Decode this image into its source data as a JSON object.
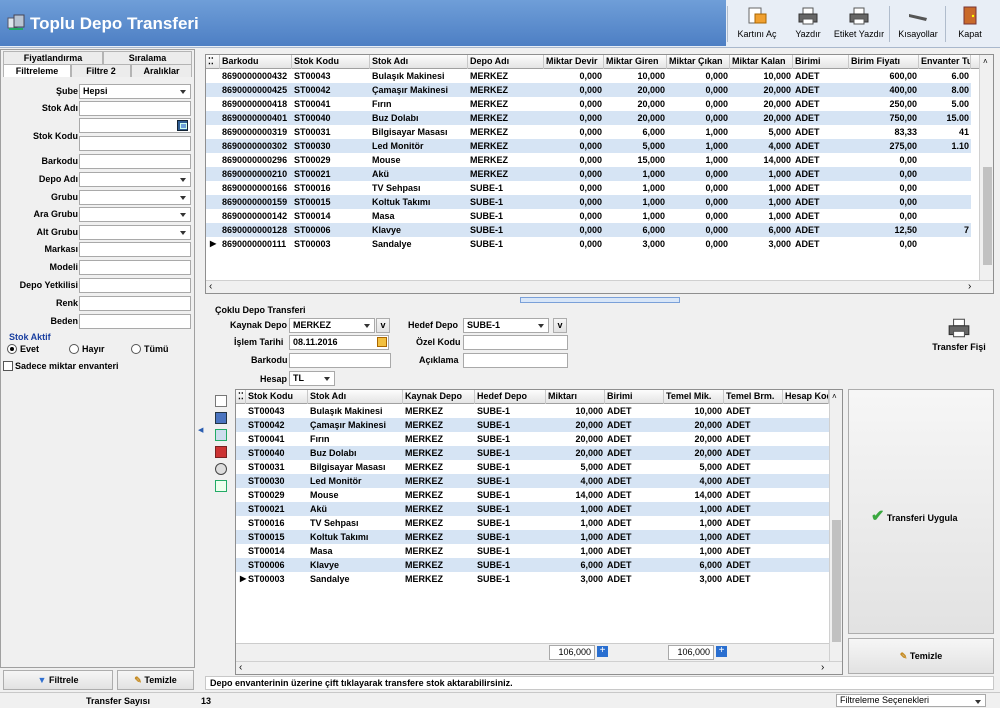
{
  "window": {
    "title": "Toplu Depo Transferi"
  },
  "toolbar": [
    {
      "label": "Kartını Aç",
      "icon": "card-open-icon"
    },
    {
      "label": "Yazdır",
      "icon": "printer-icon"
    },
    {
      "label": "Etiket Yazdır",
      "icon": "label-printer-icon"
    },
    {
      "label": "Kısayollar",
      "icon": "shortcuts-icon"
    },
    {
      "label": "Kapat",
      "icon": "close-door-icon"
    }
  ],
  "left": {
    "tabs_top": [
      "Fiyatlandırma",
      "Sıralama"
    ],
    "tabs_bottom": [
      "Filtreleme",
      "Filtre 2",
      "Aralıklar"
    ],
    "fields": {
      "sube": {
        "label": "Şube",
        "value": "Hepsi"
      },
      "stok_adi": {
        "label": "Stok Adı",
        "value": ""
      },
      "stok_kodu": {
        "label": "Stok Kodu",
        "value": ""
      },
      "barkodu": {
        "label": "Barkodu",
        "value": ""
      },
      "depo_adi": {
        "label": "Depo Adı",
        "value": ""
      },
      "grubu": {
        "label": "Grubu",
        "value": ""
      },
      "ara_grubu": {
        "label": "Ara Grubu",
        "value": ""
      },
      "alt_grubu": {
        "label": "Alt Grubu",
        "value": ""
      },
      "markasi": {
        "label": "Markası",
        "value": ""
      },
      "modeli": {
        "label": "Modeli",
        "value": ""
      },
      "depo_yetkilisi": {
        "label": "Depo Yetkilisi",
        "value": ""
      },
      "renk": {
        "label": "Renk",
        "value": ""
      },
      "beden": {
        "label": "Beden",
        "value": ""
      }
    },
    "stok_aktif": {
      "title": "Stok Aktif",
      "options": [
        "Evet",
        "Hayır",
        "Tümü"
      ],
      "selected": "Evet"
    },
    "sadece_miktar": {
      "label": "Sadece miktar envanteri",
      "checked": false
    },
    "filtrele": "Filtrele",
    "temizle": "Temizle"
  },
  "top_grid": {
    "columns": [
      "Barkodu",
      "Stok Kodu",
      "Stok Adı",
      "Depo Adı",
      "Miktar Devir",
      "Miktar Giren",
      "Miktar Çıkan",
      "Miktar Kalan",
      "Birimi",
      "Birim Fiyatı",
      "Envanter Tu"
    ],
    "rows": [
      [
        "8690000000432",
        "ST00043",
        "Bulaşık Makinesi",
        "MERKEZ",
        "0,000",
        "10,000",
        "0,000",
        "10,000",
        "ADET",
        "600,00",
        "6.00"
      ],
      [
        "8690000000425",
        "ST00042",
        "Çamaşır Makinesi",
        "MERKEZ",
        "0,000",
        "20,000",
        "0,000",
        "20,000",
        "ADET",
        "400,00",
        "8.00"
      ],
      [
        "8690000000418",
        "ST00041",
        "Fırın",
        "MERKEZ",
        "0,000",
        "20,000",
        "0,000",
        "20,000",
        "ADET",
        "250,00",
        "5.00"
      ],
      [
        "8690000000401",
        "ST00040",
        "Buz Dolabı",
        "MERKEZ",
        "0,000",
        "20,000",
        "0,000",
        "20,000",
        "ADET",
        "750,00",
        "15.00"
      ],
      [
        "8690000000319",
        "ST00031",
        "Bilgisayar Masası",
        "MERKEZ",
        "0,000",
        "6,000",
        "1,000",
        "5,000",
        "ADET",
        "83,33",
        "41"
      ],
      [
        "8690000000302",
        "ST00030",
        "Led Monitör",
        "MERKEZ",
        "0,000",
        "5,000",
        "1,000",
        "4,000",
        "ADET",
        "275,00",
        "1.10"
      ],
      [
        "8690000000296",
        "ST00029",
        "Mouse",
        "MERKEZ",
        "0,000",
        "15,000",
        "1,000",
        "14,000",
        "ADET",
        "0,00",
        ""
      ],
      [
        "8690000000210",
        "ST00021",
        "Akü",
        "MERKEZ",
        "0,000",
        "1,000",
        "0,000",
        "1,000",
        "ADET",
        "0,00",
        ""
      ],
      [
        "8690000000166",
        "ST00016",
        "TV Sehpası",
        "SUBE-1",
        "0,000",
        "1,000",
        "0,000",
        "1,000",
        "ADET",
        "0,00",
        ""
      ],
      [
        "8690000000159",
        "ST00015",
        "Koltuk Takımı",
        "SUBE-1",
        "0,000",
        "1,000",
        "0,000",
        "1,000",
        "ADET",
        "0,00",
        ""
      ],
      [
        "8690000000142",
        "ST00014",
        "Masa",
        "SUBE-1",
        "0,000",
        "1,000",
        "0,000",
        "1,000",
        "ADET",
        "0,00",
        ""
      ],
      [
        "8690000000128",
        "ST00006",
        "Klavye",
        "SUBE-1",
        "0,000",
        "6,000",
        "0,000",
        "6,000",
        "ADET",
        "12,50",
        "7"
      ],
      [
        "8690000000111",
        "ST00003",
        "Sandalye",
        "SUBE-1",
        "0,000",
        "3,000",
        "0,000",
        "3,000",
        "ADET",
        "0,00",
        ""
      ]
    ]
  },
  "transfer": {
    "section_title": "Çoklu Depo Transferi",
    "kaynak_depo": {
      "label": "Kaynak Depo",
      "value": "MERKEZ"
    },
    "hedef_depo": {
      "label": "Hedef Depo",
      "value": "SUBE-1"
    },
    "islem_tarihi": {
      "label": "İşlem Tarihi",
      "value": "08.11.2016"
    },
    "ozel_kodu": {
      "label": "Özel Kodu",
      "value": ""
    },
    "barkodu": {
      "label": "Barkodu",
      "value": ""
    },
    "aciklama": {
      "label": "Açıklama",
      "value": ""
    },
    "hesap": {
      "label": "Hesap",
      "value": "TL"
    },
    "v_label": "v",
    "fis_label": "Transfer Fişi",
    "uygula": "Transferi Uygula",
    "temizle": "Temizle"
  },
  "bottom_grid": {
    "columns": [
      "Stok Kodu",
      "Stok Adı",
      "Kaynak Depo",
      "Hedef Depo",
      "Miktarı",
      "Birimi",
      "Temel Mik.",
      "Temel Brm.",
      "Hesap Kod"
    ],
    "rows": [
      [
        "ST00043",
        "Bulaşık Makinesi",
        "MERKEZ",
        "SUBE-1",
        "10,000",
        "ADET",
        "10,000",
        "ADET"
      ],
      [
        "ST00042",
        "Çamaşır Makinesi",
        "MERKEZ",
        "SUBE-1",
        "20,000",
        "ADET",
        "20,000",
        "ADET"
      ],
      [
        "ST00041",
        "Fırın",
        "MERKEZ",
        "SUBE-1",
        "20,000",
        "ADET",
        "20,000",
        "ADET"
      ],
      [
        "ST00040",
        "Buz Dolabı",
        "MERKEZ",
        "SUBE-1",
        "20,000",
        "ADET",
        "20,000",
        "ADET"
      ],
      [
        "ST00031",
        "Bilgisayar Masası",
        "MERKEZ",
        "SUBE-1",
        "5,000",
        "ADET",
        "5,000",
        "ADET"
      ],
      [
        "ST00030",
        "Led Monitör",
        "MERKEZ",
        "SUBE-1",
        "4,000",
        "ADET",
        "4,000",
        "ADET"
      ],
      [
        "ST00029",
        "Mouse",
        "MERKEZ",
        "SUBE-1",
        "14,000",
        "ADET",
        "14,000",
        "ADET"
      ],
      [
        "ST00021",
        "Akü",
        "MERKEZ",
        "SUBE-1",
        "1,000",
        "ADET",
        "1,000",
        "ADET"
      ],
      [
        "ST00016",
        "TV Sehpası",
        "MERKEZ",
        "SUBE-1",
        "1,000",
        "ADET",
        "1,000",
        "ADET"
      ],
      [
        "ST00015",
        "Koltuk Takımı",
        "MERKEZ",
        "SUBE-1",
        "1,000",
        "ADET",
        "1,000",
        "ADET"
      ],
      [
        "ST00014",
        "Masa",
        "MERKEZ",
        "SUBE-1",
        "1,000",
        "ADET",
        "1,000",
        "ADET"
      ],
      [
        "ST00006",
        "Klavye",
        "MERKEZ",
        "SUBE-1",
        "6,000",
        "ADET",
        "6,000",
        "ADET"
      ],
      [
        "ST00003",
        "Sandalye",
        "MERKEZ",
        "SUBE-1",
        "3,000",
        "ADET",
        "3,000",
        "ADET"
      ]
    ],
    "totals": {
      "miktar": "106,000",
      "temel": "106,000"
    }
  },
  "hint": "Depo envanterinin üzerine çift tıklayarak transfere stok aktarabilirsiniz.",
  "status": {
    "label": "Transfer Sayısı",
    "value": "13",
    "filter_options": "Filtreleme Seçenekleri"
  },
  "colors": {
    "title_bar": "#4d7fc4",
    "row_alt": "#d6e4f4"
  }
}
